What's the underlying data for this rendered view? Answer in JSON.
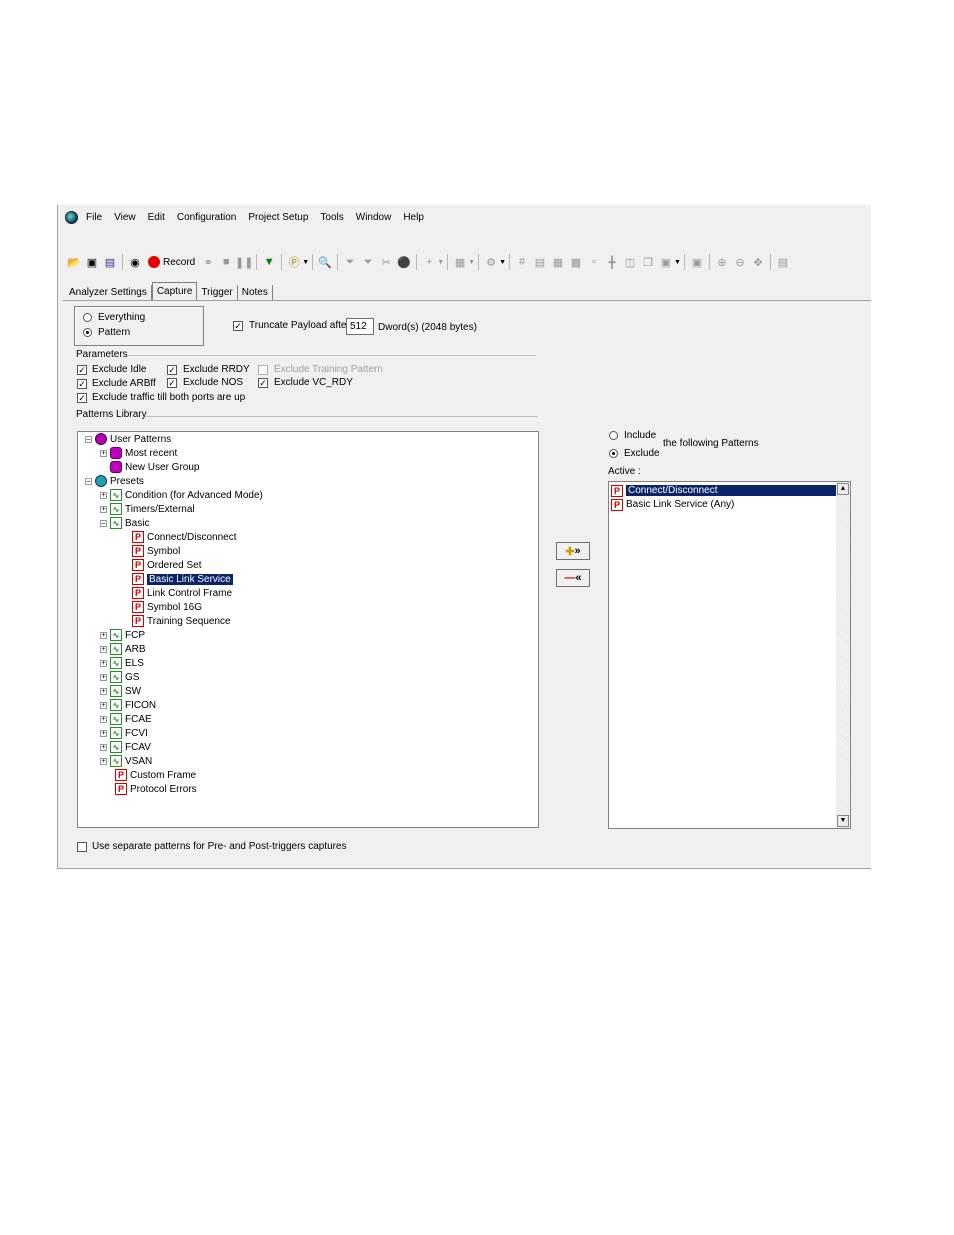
{
  "menu": [
    "File",
    "View",
    "Edit",
    "Configuration",
    "Project Setup",
    "Tools",
    "Window",
    "Help"
  ],
  "toolbar": {
    "record_label": "Record"
  },
  "tabs": [
    "Analyzer Settings",
    "Capture",
    "Trigger",
    "Notes"
  ],
  "mode": {
    "options": [
      "Everything",
      "Pattern"
    ],
    "selected": "Pattern"
  },
  "truncate": {
    "label": "Truncate Payload after",
    "value": "512",
    "suffix": "Dword(s) (2048 bytes)",
    "checked": true
  },
  "parameters": {
    "title": "Parameters",
    "items": [
      {
        "label": "Exclude Idle",
        "checked": true,
        "enabled": true
      },
      {
        "label": "Exclude RRDY",
        "checked": true,
        "enabled": true
      },
      {
        "label": "Exclude Training Pattern",
        "checked": false,
        "enabled": false
      },
      {
        "label": "Exclude ARBff",
        "checked": true,
        "enabled": true
      },
      {
        "label": "Exclude NOS",
        "checked": true,
        "enabled": true
      },
      {
        "label": "Exclude VC_RDY",
        "checked": true,
        "enabled": true
      },
      {
        "label": "Exclude traffic till both ports are up",
        "checked": true,
        "enabled": true
      }
    ]
  },
  "library": {
    "title": "Patterns Library",
    "tree": [
      {
        "label": "User Patterns",
        "icon": "user-patterns-icon"
      },
      {
        "label": "Most recent",
        "icon": "group-icon"
      },
      {
        "label": "New User Group",
        "icon": "group-icon"
      },
      {
        "label": "Presets",
        "icon": "presets-icon"
      },
      {
        "label": "Condition (for Advanced Mode)",
        "icon": "wave-icon"
      },
      {
        "label": "Timers/External",
        "icon": "wave-icon"
      },
      {
        "label": "Basic",
        "icon": "wave-icon"
      },
      {
        "label": "Connect/Disconnect",
        "icon": "pattern-icon"
      },
      {
        "label": "Symbol",
        "icon": "pattern-icon"
      },
      {
        "label": "Ordered Set",
        "icon": "pattern-icon"
      },
      {
        "label": "Basic Link Service",
        "icon": "pattern-icon",
        "selected": true
      },
      {
        "label": "Link Control Frame",
        "icon": "pattern-icon"
      },
      {
        "label": "Symbol 16G",
        "icon": "pattern-icon"
      },
      {
        "label": "Training Sequence",
        "icon": "pattern-icon"
      },
      {
        "label": "FCP",
        "icon": "wave-icon"
      },
      {
        "label": "ARB",
        "icon": "wave-icon"
      },
      {
        "label": "ELS",
        "icon": "wave-icon"
      },
      {
        "label": "GS",
        "icon": "wave-icon"
      },
      {
        "label": "SW",
        "icon": "wave-icon"
      },
      {
        "label": "FICON",
        "icon": "wave-icon"
      },
      {
        "label": "FCAE",
        "icon": "wave-icon"
      },
      {
        "label": "FCVI",
        "icon": "wave-icon"
      },
      {
        "label": "FCAV",
        "icon": "wave-icon"
      },
      {
        "label": "VSAN",
        "icon": "wave-icon"
      },
      {
        "label": "Custom Frame",
        "icon": "pattern-icon"
      },
      {
        "label": "Protocol Errors",
        "icon": "pattern-icon"
      }
    ]
  },
  "filter": {
    "options": [
      "Include",
      "Exclude"
    ],
    "selected": "Exclude",
    "suffix": "the following Patterns",
    "active_label": "Active :"
  },
  "active": [
    {
      "label": "Connect/Disconnect",
      "selected": true
    },
    {
      "label": "Basic Link Service (Any)",
      "selected": false
    }
  ],
  "footer": {
    "separate_label": "Use separate patterns for Pre- and Post-triggers captures",
    "checked": false
  }
}
